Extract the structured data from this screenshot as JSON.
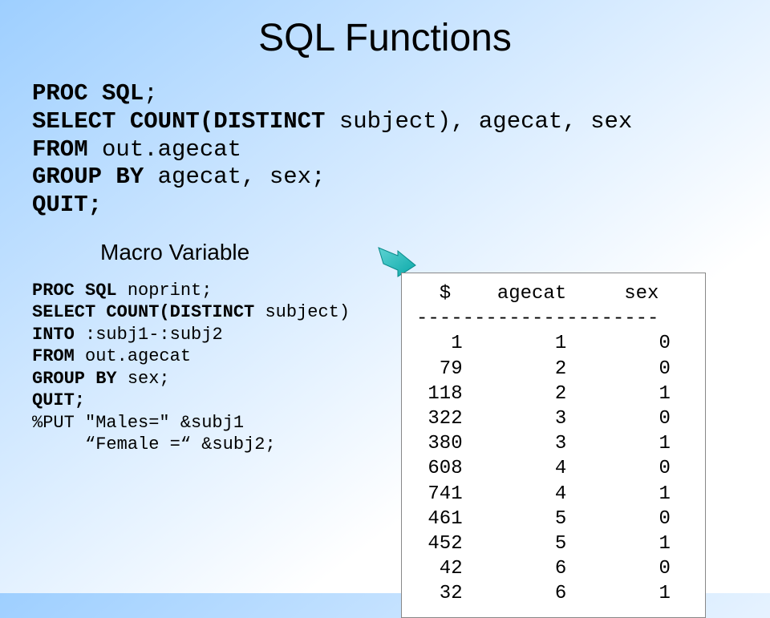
{
  "title": "SQL Functions",
  "code1": {
    "l1_kw": "PROC SQL",
    "l1_plain": ";",
    "l2_kw": "SELECT COUNT(DISTINCT ",
    "l2_plain": "subject), agecat, sex",
    "l3_kw": "FROM ",
    "l3_plain": "out.agecat",
    "l4_kw": "GROUP BY ",
    "l4_plain": "agecat, sex;",
    "l5_kw": "QUIT;"
  },
  "subheading": "Macro Variable",
  "code2": {
    "l1_kw": "PROC SQL ",
    "l1_plain": "noprint;",
    "l2_kw": "SELECT COUNT(DISTINCT ",
    "l2_plain": "subject)",
    "l3_kw": "INTO ",
    "l3_plain": ":subj1-:subj2",
    "l4_kw": "FROM ",
    "l4_plain": "out.agecat",
    "l5_kw": "GROUP BY ",
    "l5_plain": "sex;",
    "l6_kw": "QUIT;",
    "l7_plain": "%PUT \"Males=\" &subj1",
    "l8_plain": "     “Female =“ &subj2;"
  },
  "output": {
    "header": "  $    agecat     sex",
    "divider": "---------------------",
    "rows": [
      "   1        1        0",
      "  79        2        0",
      " 118        2        1",
      " 322        3        0",
      " 380        3        1",
      " 608        4        0",
      " 741        4        1",
      " 461        5        0",
      " 452        5        1",
      "  42        6        0",
      "  32        6        1"
    ]
  },
  "chart_data": {
    "type": "table",
    "title": "SQL Functions output",
    "columns": [
      "$",
      "agecat",
      "sex"
    ],
    "rows": [
      [
        1,
        1,
        0
      ],
      [
        79,
        2,
        0
      ],
      [
        118,
        2,
        1
      ],
      [
        322,
        3,
        0
      ],
      [
        380,
        3,
        1
      ],
      [
        608,
        4,
        0
      ],
      [
        741,
        4,
        1
      ],
      [
        461,
        5,
        0
      ],
      [
        452,
        5,
        1
      ],
      [
        42,
        6,
        0
      ],
      [
        32,
        6,
        1
      ]
    ]
  }
}
